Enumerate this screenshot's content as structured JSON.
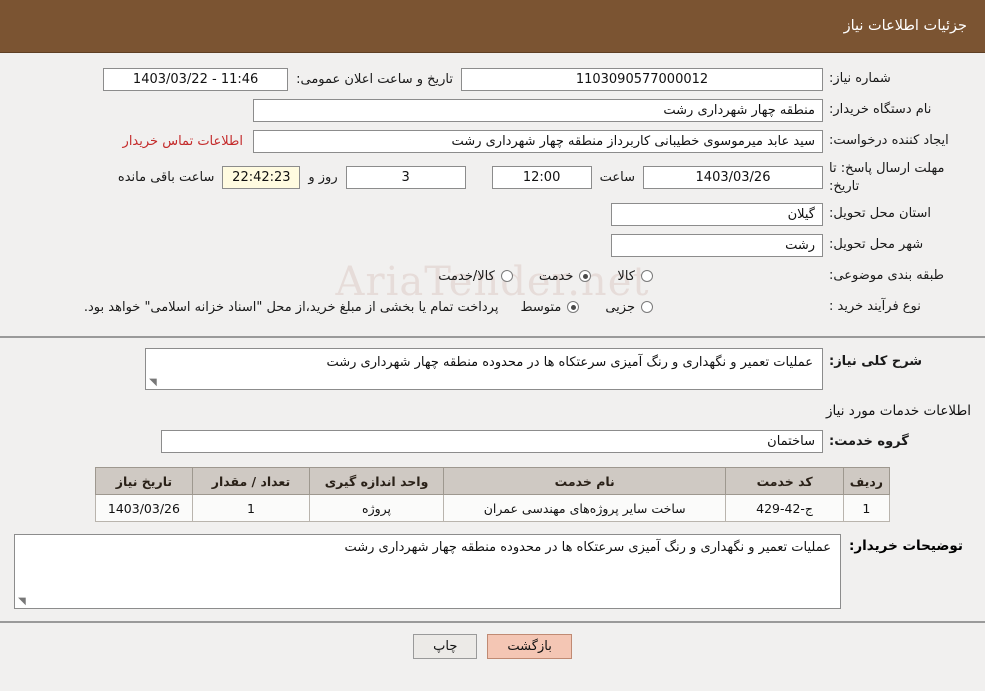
{
  "header": {
    "title": "جزئیات اطلاعات نیاز"
  },
  "top": {
    "need_number_label": "شماره نیاز:",
    "need_number_value": "1103090577000012",
    "publish_datetime_label": "تاریخ و ساعت اعلان عمومی:",
    "publish_datetime_value": "11:46 - 1403/03/22",
    "buyer_org_label": "نام دستگاه خریدار:",
    "buyer_org_value": "منطقه چهار شهرداری رشت",
    "requester_label": "ایجاد کننده درخواست:",
    "requester_value": "سید عابد میرموسوی خطیبانی کاربرداز منطقه چهار شهرداری رشت",
    "contact_link": "اطلاعات تماس خریدار",
    "deadline_label": "مهلت ارسال پاسخ: تا تاریخ:",
    "deadline_date": "1403/03/26",
    "hour_label": "ساعت",
    "hour_value": "12:00",
    "days_value": "3",
    "days_label": "روز و",
    "remaining_value": "22:42:23",
    "remaining_label": "ساعت باقی مانده",
    "province_label": "استان محل تحویل:",
    "province_value": "گیلان",
    "city_label": "شهر محل تحویل:",
    "city_value": "رشت",
    "category_label": "طبقه بندی موضوعی:",
    "category_options": [
      {
        "label": "کالا",
        "selected": false
      },
      {
        "label": "خدمت",
        "selected": true
      },
      {
        "label": "کالا/خدمت",
        "selected": false
      }
    ],
    "process_label": "نوع فرآیند خرید :",
    "process_options": [
      {
        "label": "جزیی",
        "selected": false
      },
      {
        "label": "متوسط",
        "selected": true
      }
    ],
    "process_note": "پرداخت تمام یا بخشی از مبلغ خرید،از محل \"اسناد خزانه اسلامی\" خواهد بود.",
    "watermark_text": "AriaTender.net"
  },
  "middle": {
    "general_desc_label": "شرح کلی نیاز:",
    "general_desc_value": "عملیات تعمیر و نگهداری و رنگ آمیزی سرعتکاه ها در محدوده منطقه چهار شهرداری رشت",
    "services_section_title": "اطلاعات خدمات مورد نیاز",
    "service_group_label": "گروه خدمت:",
    "service_group_value": "ساختمان",
    "table": {
      "headers": [
        "ردیف",
        "کد خدمت",
        "نام خدمت",
        "واحد اندازه گیری",
        "تعداد / مقدار",
        "تاریخ نیاز"
      ],
      "rows": [
        [
          "1",
          "ج-42-429",
          "ساخت سایر پروژه‌های مهندسی عمران",
          "پروژه",
          "1",
          "1403/03/26"
        ]
      ]
    },
    "buyer_notes_label": "توضیحات خریدار:",
    "buyer_notes_value": "عملیات تعمیر و نگهداری و رنگ آمیزی سرعتکاه ها در محدوده منطقه چهار شهرداری رشت"
  },
  "footer": {
    "back_label": "بازگشت",
    "print_label": "چاپ"
  },
  "colors": {
    "header_bg": "#7b5432",
    "link": "#c42b2b",
    "back_button": "#f4c6b4"
  }
}
